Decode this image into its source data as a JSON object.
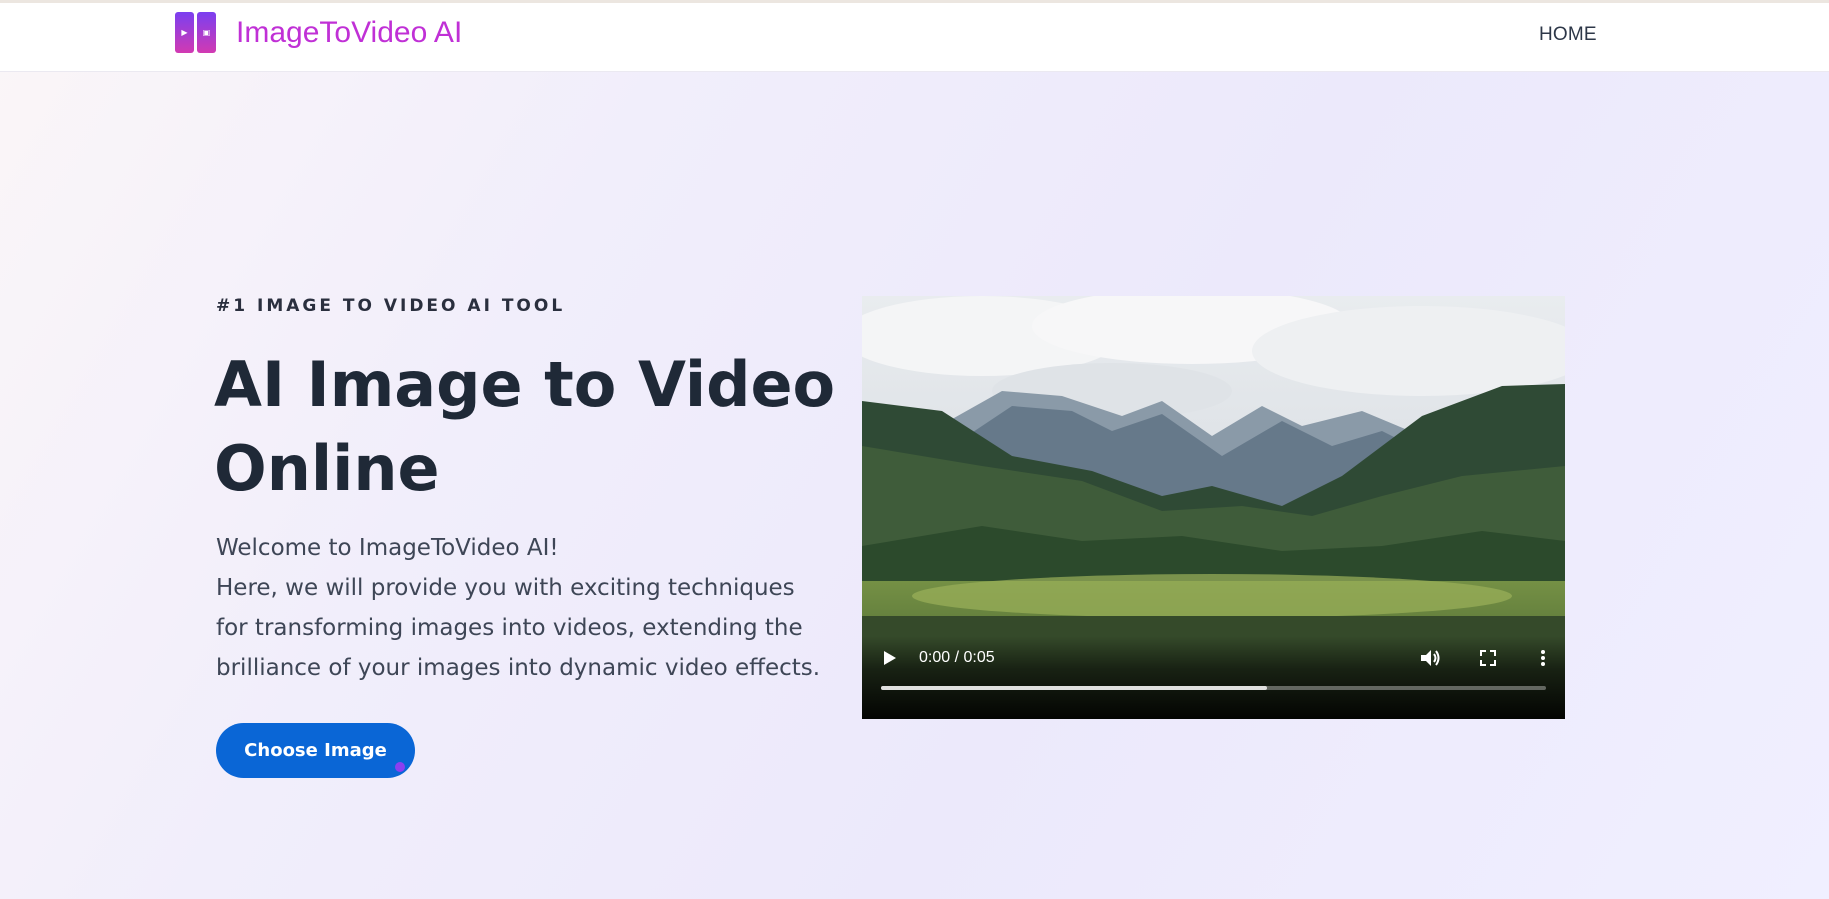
{
  "nav": {
    "brand": "ImageToVideo AI",
    "links": [
      {
        "label": "HOME"
      }
    ]
  },
  "hero": {
    "eyebrow": "#1 IMAGE TO VIDEO AI TOOL",
    "title_line1": "AI Image to Video",
    "title_line2": "Online",
    "intro_lines": [
      "Welcome to ImageToVideo AI!",
      "Here, we will provide you with exciting techniques",
      "for transforming images into videos, extending the",
      "brilliance of your images into dynamic video effects."
    ],
    "cta_label": "Choose Image"
  },
  "video": {
    "time_display": "0:00 / 0:05",
    "buffered_fraction": 0.58,
    "icons": [
      "play-icon",
      "volume-icon",
      "fullscreen-icon",
      "more-options-icon"
    ]
  },
  "colors": {
    "brand": "#c030d6",
    "cta": "#0a66d6",
    "heading": "#1f2937"
  }
}
